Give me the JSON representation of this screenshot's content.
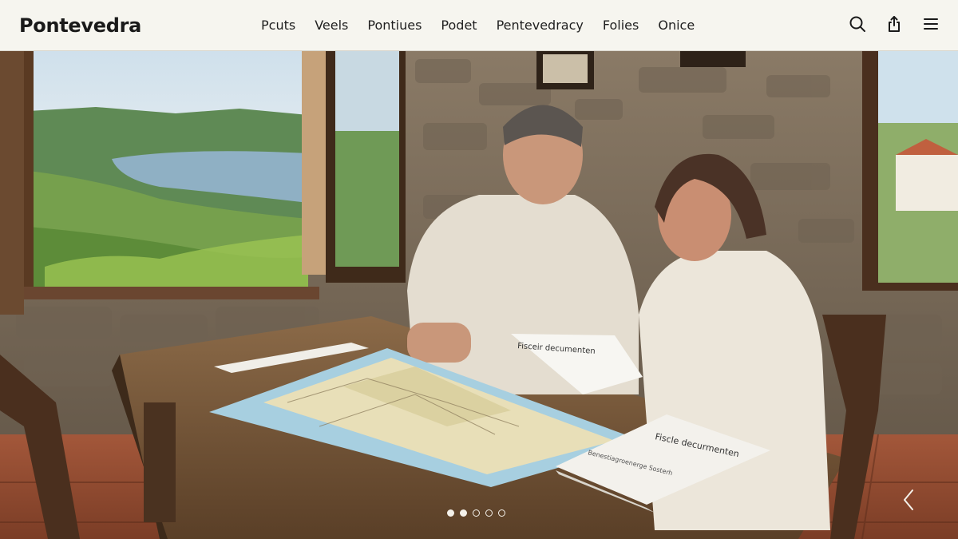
{
  "brand": {
    "name": "Pontevedra"
  },
  "nav": {
    "items": [
      {
        "label": "Pcuts"
      },
      {
        "label": "Veels"
      },
      {
        "label": "Pontiues"
      },
      {
        "label": "Podet"
      },
      {
        "label": "Pentevedracy"
      },
      {
        "label": "Folies"
      },
      {
        "label": "Onice"
      }
    ]
  },
  "header_icons": [
    "search-icon",
    "share-icon",
    "menu-icon"
  ],
  "hero": {
    "document_heading_1": "Fisceir decumenten",
    "document_heading_2": "Fiscle decurmenten",
    "document_subtitle": "Benestiagroenerge Sosterh"
  },
  "carousel": {
    "slide_count": 5,
    "active_slides": [
      0,
      1
    ],
    "next_icon": "chevron-right-icon"
  },
  "colors": {
    "header_bg": "#f6f5ef",
    "text": "#1a1a1a",
    "dot": "#f4f1ea"
  }
}
